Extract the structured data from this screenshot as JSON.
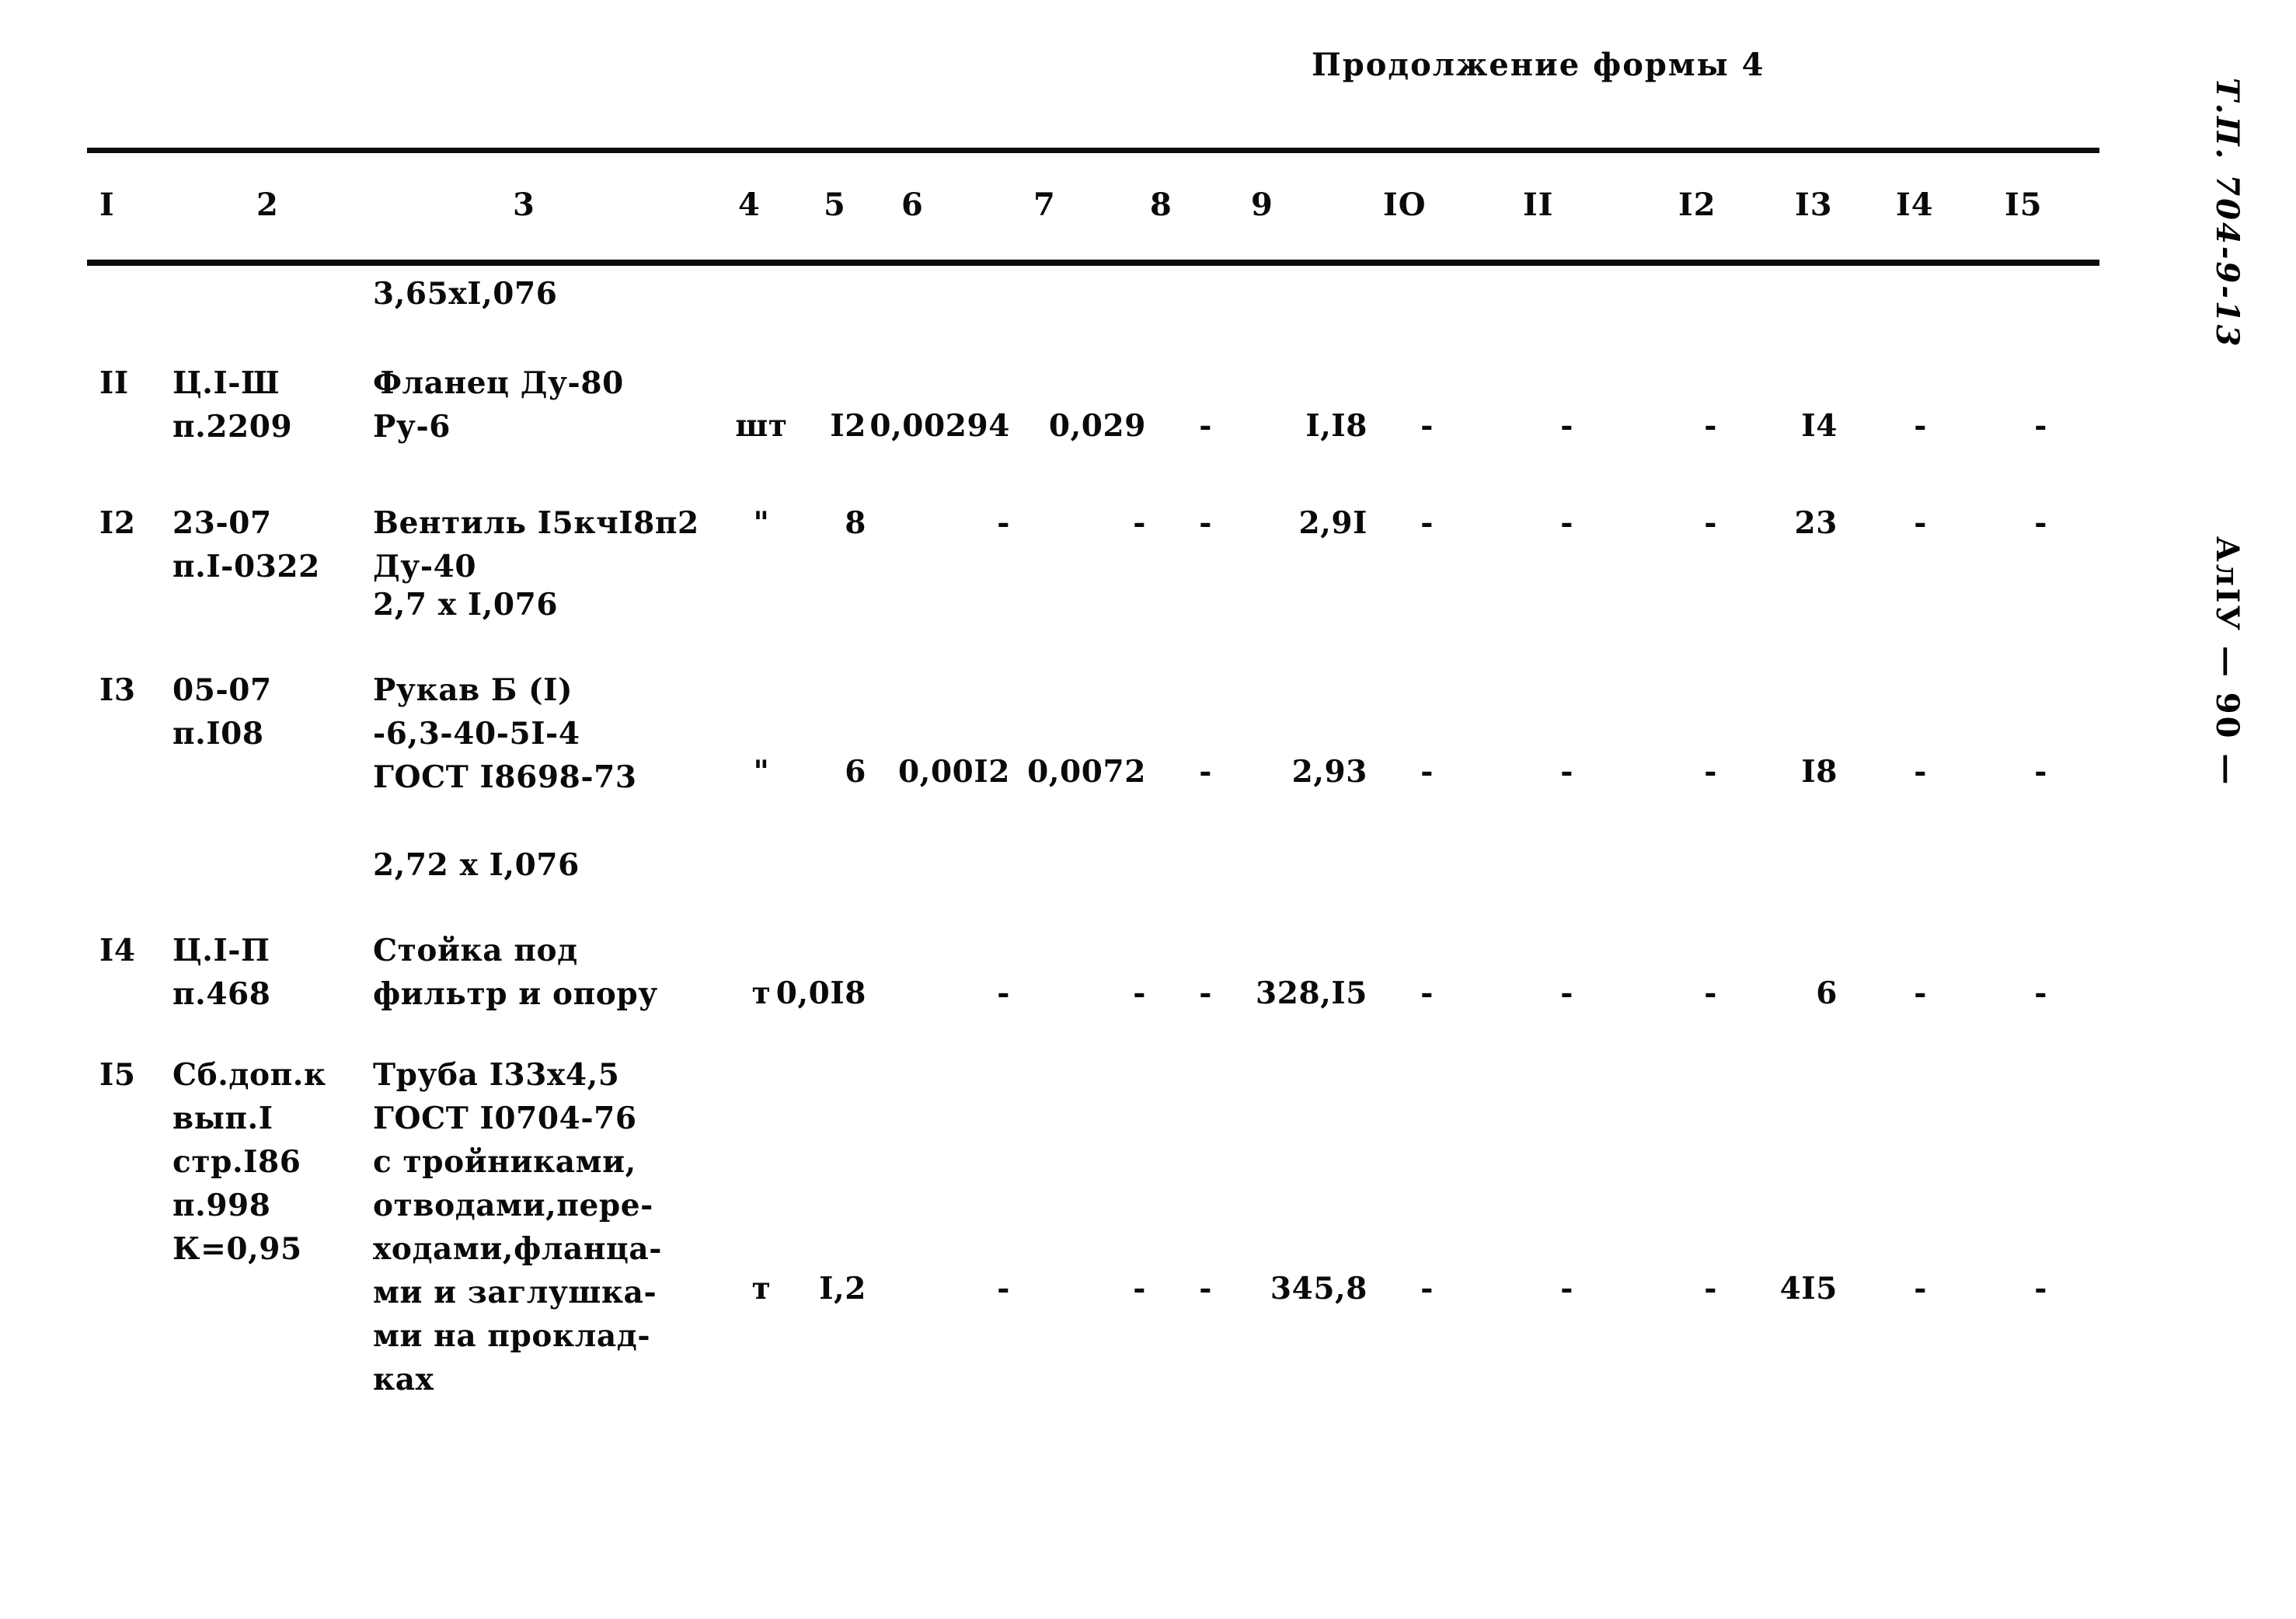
{
  "page": {
    "form_continuation_title": "Продолжение формы 4",
    "project_code_stamp": "Т.П. 704-9-13",
    "album_page_stamp": "АлIУ  —  90  —"
  },
  "table": {
    "column_headers": [
      "I",
      "2",
      "3",
      "4",
      "5",
      "6",
      "7",
      "8",
      "9",
      "IO",
      "II",
      "I2",
      "I3",
      "I4",
      "I5"
    ],
    "standalone_notes": [
      {
        "text": "3,65xI,076"
      },
      {
        "text": "2,7 x I,076"
      },
      {
        "text": "2,72 x I,076"
      }
    ],
    "rows": [
      {
        "no": "II",
        "code": "Ц.I-Ш\nп.2209",
        "name": "Фланец Ду-80\nРу-6",
        "unit": "шт",
        "c5": "I2",
        "c6": "0,00294",
        "c7": "0,029",
        "c8": "-",
        "c9": "I,I8",
        "c10": "-",
        "c11": "-",
        "c12": "-",
        "c13": "I4",
        "c14": "-",
        "c15": "-"
      },
      {
        "no": "I2",
        "code": "23-07\nп.I-0322",
        "name": "Вентиль I5кчI8п2\nДу-40",
        "unit": "\"",
        "c5": "8",
        "c6": "-",
        "c7": "-",
        "c8": "-",
        "c9": "2,9I",
        "c10": "-",
        "c11": "-",
        "c12": "-",
        "c13": "23",
        "c14": "-",
        "c15": "-"
      },
      {
        "no": "I3",
        "code": "05-07\nп.I08",
        "name": "Рукав Б (I)\n-6,3-40-5I-4\nГОСТ I8698-73",
        "unit": "\"",
        "c5": "6",
        "c6": "0,00I2",
        "c7": "0,0072",
        "c8": "-",
        "c9": "2,93",
        "c10": "-",
        "c11": "-",
        "c12": "-",
        "c13": "I8",
        "c14": "-",
        "c15": "-"
      },
      {
        "no": "I4",
        "code": "Ц.I-П\nп.468",
        "name": "Стойка под\nфильтр и опору",
        "unit": "т",
        "c5": "0,0I8",
        "c6": "-",
        "c7": "-",
        "c8": "-",
        "c9": "328,I5",
        "c10": "-",
        "c11": "-",
        "c12": "-",
        "c13": "6",
        "c14": "-",
        "c15": "-"
      },
      {
        "no": "I5",
        "code": "Сб.доп.к\nвып.I\nстр.I86\nп.998\nК=0,95",
        "name": "Труба I33х4,5\nГОСТ I0704-76\nс тройниками,\nотводами,пере-\nходами,фланца-\nми и заглушка-\nми на проклад-\nках",
        "unit": "т",
        "c5": "I,2",
        "c6": "-",
        "c7": "-",
        "c8": "-",
        "c9": "345,8",
        "c10": "-",
        "c11": "-",
        "c12": "-",
        "c13": "4I5",
        "c14": "-",
        "c15": "-"
      }
    ]
  }
}
